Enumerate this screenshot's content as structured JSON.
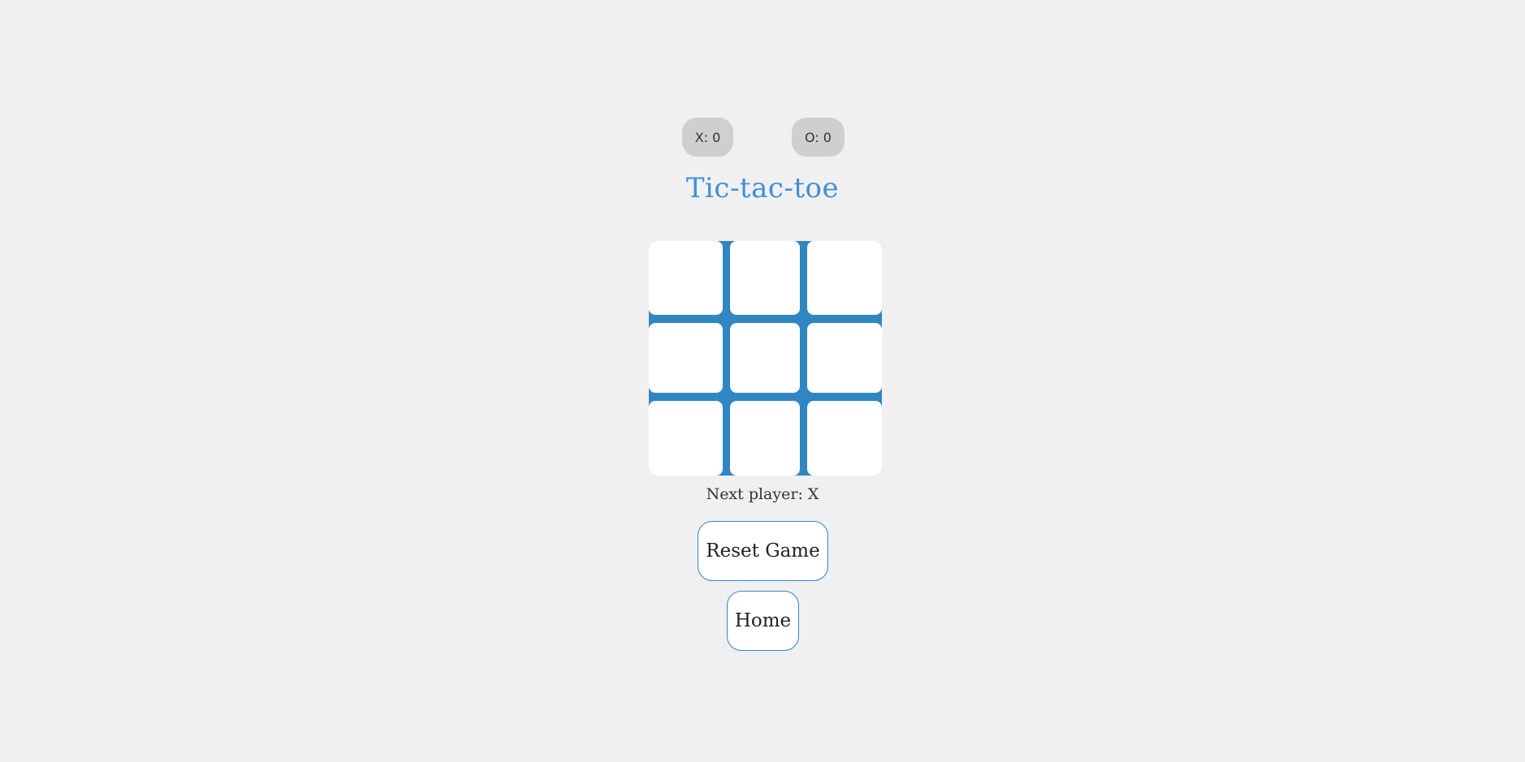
{
  "scores": {
    "x_label": "X: 0",
    "o_label": "O: 0"
  },
  "title": "Tic-tac-toe",
  "board": {
    "cells": [
      "",
      "",
      "",
      "",
      "",
      "",
      "",
      "",
      ""
    ]
  },
  "status": "Next player: X",
  "buttons": {
    "reset": "Reset Game",
    "home": "Home"
  },
  "colors": {
    "accent": "#3f8fd8",
    "board_lines": "#2f86c3",
    "background": "#f0f0f0",
    "score_badge": "#cfcfcf"
  }
}
